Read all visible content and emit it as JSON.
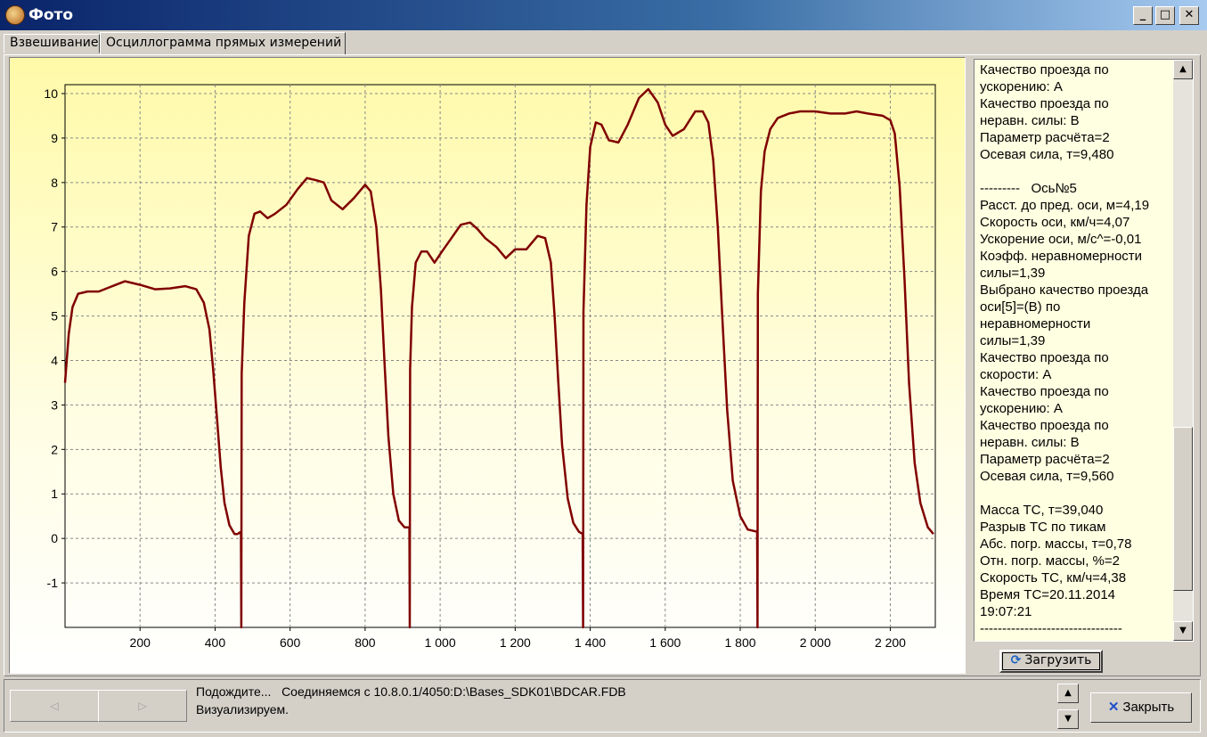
{
  "window": {
    "title": "Фото",
    "minimize_glyph": "_",
    "maximize_glyph": "□",
    "close_glyph": "✕"
  },
  "tabs": [
    {
      "label": "Взвешивание",
      "active": false
    },
    {
      "label": "Осциллограмма прямых измерений",
      "active": true
    }
  ],
  "chart_data": {
    "type": "line",
    "xlim": [
      0,
      2320
    ],
    "ylim": [
      -2,
      10.2
    ],
    "x_ticks": [
      {
        "value": 200,
        "label": "200"
      },
      {
        "value": 400,
        "label": "400"
      },
      {
        "value": 600,
        "label": "600"
      },
      {
        "value": 800,
        "label": "800"
      },
      {
        "value": 1000,
        "label": "1 000"
      },
      {
        "value": 1200,
        "label": "1 200"
      },
      {
        "value": 1400,
        "label": "1 400"
      },
      {
        "value": 1600,
        "label": "1 600"
      },
      {
        "value": 1800,
        "label": "1 800"
      },
      {
        "value": 2000,
        "label": "2 000"
      },
      {
        "value": 2200,
        "label": "2 200"
      }
    ],
    "y_ticks": [
      {
        "value": 10,
        "label": "10"
      },
      {
        "value": 9,
        "label": "9"
      },
      {
        "value": 8,
        "label": "8"
      },
      {
        "value": 7,
        "label": "7"
      },
      {
        "value": 6,
        "label": "6"
      },
      {
        "value": 5,
        "label": "5"
      },
      {
        "value": 4,
        "label": "4"
      },
      {
        "value": 3,
        "label": "3"
      },
      {
        "value": 2,
        "label": "2"
      },
      {
        "value": 1,
        "label": "1"
      },
      {
        "value": 0,
        "label": "0"
      },
      {
        "value": -1,
        "label": "-1"
      }
    ],
    "grid": true,
    "series": [
      {
        "color": "#800000",
        "points": [
          [
            0,
            3.5
          ],
          [
            10,
            4.6
          ],
          [
            20,
            5.2
          ],
          [
            35,
            5.5
          ],
          [
            60,
            5.55
          ],
          [
            90,
            5.55
          ],
          [
            120,
            5.65
          ],
          [
            160,
            5.78
          ],
          [
            200,
            5.7
          ],
          [
            240,
            5.6
          ],
          [
            280,
            5.62
          ],
          [
            320,
            5.67
          ],
          [
            350,
            5.6
          ],
          [
            370,
            5.3
          ],
          [
            385,
            4.7
          ],
          [
            395,
            3.8
          ],
          [
            405,
            2.7
          ],
          [
            415,
            1.6
          ],
          [
            425,
            0.8
          ],
          [
            438,
            0.3
          ],
          [
            452,
            0.1
          ],
          [
            460,
            0.1
          ],
          [
            469,
            0.15
          ],
          [
            470,
            -2
          ],
          [
            471,
            3.7
          ],
          [
            478,
            5.3
          ],
          [
            490,
            6.8
          ],
          [
            505,
            7.3
          ],
          [
            520,
            7.35
          ],
          [
            540,
            7.2
          ],
          [
            560,
            7.3
          ],
          [
            590,
            7.5
          ],
          [
            620,
            7.85
          ],
          [
            645,
            8.1
          ],
          [
            670,
            8.05
          ],
          [
            690,
            8.0
          ],
          [
            710,
            7.6
          ],
          [
            740,
            7.4
          ],
          [
            770,
            7.65
          ],
          [
            800,
            7.95
          ],
          [
            815,
            7.8
          ],
          [
            830,
            7.0
          ],
          [
            842,
            5.6
          ],
          [
            852,
            3.9
          ],
          [
            862,
            2.3
          ],
          [
            875,
            1.0
          ],
          [
            890,
            0.4
          ],
          [
            905,
            0.25
          ],
          [
            918,
            0.25
          ],
          [
            919,
            -2
          ],
          [
            920,
            3.8
          ],
          [
            925,
            5.2
          ],
          [
            935,
            6.2
          ],
          [
            950,
            6.45
          ],
          [
            965,
            6.45
          ],
          [
            985,
            6.2
          ],
          [
            1005,
            6.45
          ],
          [
            1030,
            6.75
          ],
          [
            1055,
            7.05
          ],
          [
            1080,
            7.1
          ],
          [
            1100,
            6.95
          ],
          [
            1120,
            6.75
          ],
          [
            1150,
            6.55
          ],
          [
            1175,
            6.3
          ],
          [
            1200,
            6.5
          ],
          [
            1230,
            6.5
          ],
          [
            1260,
            6.8
          ],
          [
            1280,
            6.75
          ],
          [
            1295,
            6.2
          ],
          [
            1305,
            5.0
          ],
          [
            1315,
            3.5
          ],
          [
            1325,
            2.1
          ],
          [
            1340,
            0.9
          ],
          [
            1355,
            0.35
          ],
          [
            1370,
            0.15
          ],
          [
            1380,
            0.1
          ],
          [
            1381,
            -2
          ],
          [
            1382,
            5.1
          ],
          [
            1390,
            7.5
          ],
          [
            1400,
            8.8
          ],
          [
            1415,
            9.35
          ],
          [
            1430,
            9.3
          ],
          [
            1450,
            8.95
          ],
          [
            1475,
            8.9
          ],
          [
            1500,
            9.3
          ],
          [
            1530,
            9.9
          ],
          [
            1555,
            10.1
          ],
          [
            1580,
            9.8
          ],
          [
            1600,
            9.3
          ],
          [
            1620,
            9.05
          ],
          [
            1650,
            9.2
          ],
          [
            1680,
            9.6
          ],
          [
            1700,
            9.6
          ],
          [
            1715,
            9.35
          ],
          [
            1728,
            8.5
          ],
          [
            1740,
            7.0
          ],
          [
            1752,
            5.0
          ],
          [
            1765,
            2.9
          ],
          [
            1780,
            1.3
          ],
          [
            1800,
            0.5
          ],
          [
            1820,
            0.2
          ],
          [
            1845,
            0.15
          ],
          [
            1846,
            -2
          ],
          [
            1847,
            5.5
          ],
          [
            1855,
            7.8
          ],
          [
            1865,
            8.7
          ],
          [
            1880,
            9.2
          ],
          [
            1900,
            9.45
          ],
          [
            1930,
            9.55
          ],
          [
            1960,
            9.6
          ],
          [
            2000,
            9.6
          ],
          [
            2040,
            9.55
          ],
          [
            2080,
            9.55
          ],
          [
            2110,
            9.6
          ],
          [
            2140,
            9.55
          ],
          [
            2180,
            9.5
          ],
          [
            2200,
            9.4
          ],
          [
            2212,
            9.1
          ],
          [
            2225,
            7.9
          ],
          [
            2238,
            5.8
          ],
          [
            2250,
            3.5
          ],
          [
            2265,
            1.7
          ],
          [
            2280,
            0.8
          ],
          [
            2300,
            0.25
          ],
          [
            2315,
            0.1
          ]
        ]
      }
    ]
  },
  "info_text": "Качество проезда по\nускорению: А\nКачество проезда по\nнеравн. силы: В\nПараметр расчёта=2\nОсевая сила, т=9,480\n\n---------   Ось№5\nРасст. до пред. оси, м=4,19\nСкорость оси, км/ч=4,07\nУскорение оси, м/с^=-0,01\nКоэфф. неравномерности\nсилы=1,39\nВыбрано качество проезда\nоси[5]=(В) по\nнеравномерности\nсилы=1,39\nКачество проезда по\nскорости: А\nКачество проезда по\nускорению: А\nКачество проезда по\nнеравн. силы: В\nПараметр расчёта=2\nОсевая сила, т=9,560\n\nМасса ТС, т=39,040\nРазрыв ТС по тикам\nАбс. погр. массы, т=0,78\nОтн. погр. массы, %=2\nСкорость ТС, км/ч=4,38\nВремя ТС=20.11.2014\n19:07:21\n--------------------------------",
  "buttons": {
    "load_label": "Загрузить",
    "load_icon": "refresh-icon",
    "close_label": "Закрыть",
    "close_icon": "close-x-icon",
    "prev_glyph": "◁",
    "next_glyph": "▷",
    "scroll_up_glyph": "▲",
    "scroll_down_glyph": "▼"
  },
  "status": {
    "line1": "Подождите...   Соединяемся с 10.8.0.1/4050:D:\\Bases_SDK01\\BDCAR.FDB",
    "line2": "Визуализируем."
  }
}
